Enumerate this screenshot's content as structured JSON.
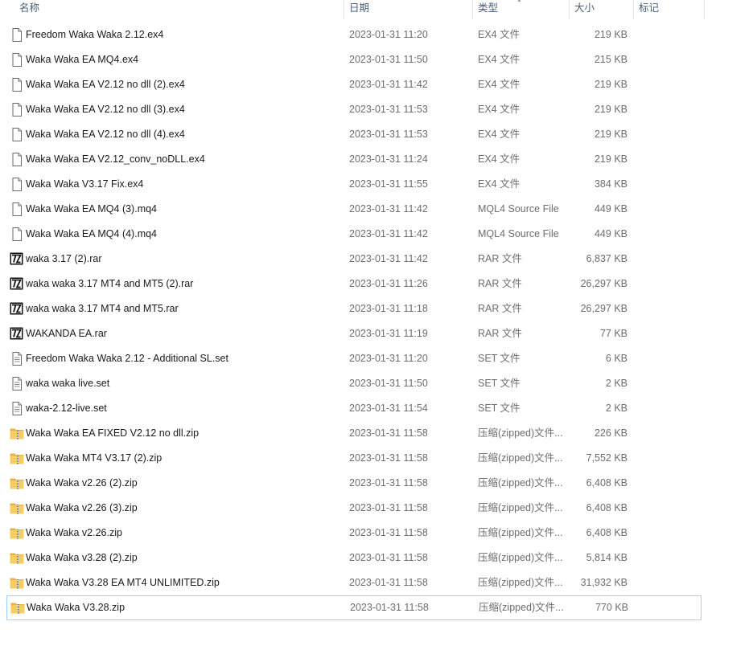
{
  "columns": {
    "name": "名称",
    "date": "日期",
    "type": "类型",
    "size": "大小",
    "tags": "标记"
  },
  "icons": {
    "ex4": "generic-file-icon",
    "mq4": "generic-file-icon",
    "rar": "7zip-archive-icon",
    "set": "text-document-icon",
    "zip": "zip-folder-icon"
  },
  "colors": {
    "selection_border": "#99d1ff",
    "header_text": "#4c607a",
    "secondary_text": "#6d6d6d",
    "folder_yellow": "#f3c55a"
  },
  "files": [
    {
      "name": "Freedom Waka Waka 2.12.ex4",
      "date": "2023-01-31 11:20",
      "type": "EX4 文件",
      "size": "219 KB",
      "icon": "ex4"
    },
    {
      "name": "Waka Waka EA MQ4.ex4",
      "date": "2023-01-31 11:50",
      "type": "EX4 文件",
      "size": "215 KB",
      "icon": "ex4"
    },
    {
      "name": "Waka Waka EA V2.12 no dll (2).ex4",
      "date": "2023-01-31 11:42",
      "type": "EX4 文件",
      "size": "219 KB",
      "icon": "ex4"
    },
    {
      "name": "Waka Waka EA V2.12 no dll (3).ex4",
      "date": "2023-01-31 11:53",
      "type": "EX4 文件",
      "size": "219 KB",
      "icon": "ex4"
    },
    {
      "name": "Waka Waka EA V2.12 no dll (4).ex4",
      "date": "2023-01-31 11:53",
      "type": "EX4 文件",
      "size": "219 KB",
      "icon": "ex4"
    },
    {
      "name": "Waka Waka EA V2.12_conv_noDLL.ex4",
      "date": "2023-01-31 11:24",
      "type": "EX4 文件",
      "size": "219 KB",
      "icon": "ex4"
    },
    {
      "name": "Waka Waka V3.17 Fix.ex4",
      "date": "2023-01-31 11:55",
      "type": "EX4 文件",
      "size": "384 KB",
      "icon": "ex4"
    },
    {
      "name": "Waka Waka EA MQ4 (3).mq4",
      "date": "2023-01-31 11:42",
      "type": "MQL4 Source File",
      "size": "449 KB",
      "icon": "mq4"
    },
    {
      "name": "Waka Waka EA MQ4 (4).mq4",
      "date": "2023-01-31 11:42",
      "type": "MQL4 Source File",
      "size": "449 KB",
      "icon": "mq4"
    },
    {
      "name": "waka 3.17 (2).rar",
      "date": "2023-01-31 11:42",
      "type": "RAR 文件",
      "size": "6,837 KB",
      "icon": "rar"
    },
    {
      "name": "waka waka 3.17 MT4 and MT5 (2).rar",
      "date": "2023-01-31 11:26",
      "type": "RAR 文件",
      "size": "26,297 KB",
      "icon": "rar"
    },
    {
      "name": "waka waka 3.17 MT4 and MT5.rar",
      "date": "2023-01-31 11:18",
      "type": "RAR 文件",
      "size": "26,297 KB",
      "icon": "rar"
    },
    {
      "name": "WAKANDA EA.rar",
      "date": "2023-01-31 11:19",
      "type": "RAR 文件",
      "size": "77 KB",
      "icon": "rar"
    },
    {
      "name": "Freedom Waka Waka 2.12 - Additional SL.set",
      "date": "2023-01-31 11:20",
      "type": "SET 文件",
      "size": "6 KB",
      "icon": "set"
    },
    {
      "name": "waka waka live.set",
      "date": "2023-01-31 11:50",
      "type": "SET 文件",
      "size": "2 KB",
      "icon": "set"
    },
    {
      "name": "waka-2.12-live.set",
      "date": "2023-01-31 11:54",
      "type": "SET 文件",
      "size": "2 KB",
      "icon": "set"
    },
    {
      "name": "Waka Waka EA FIXED V2.12 no dll.zip",
      "date": "2023-01-31 11:58",
      "type": "压缩(zipped)文件...",
      "size": "226 KB",
      "icon": "zip"
    },
    {
      "name": "Waka Waka MT4 V3.17 (2).zip",
      "date": "2023-01-31 11:58",
      "type": "压缩(zipped)文件...",
      "size": "7,552 KB",
      "icon": "zip"
    },
    {
      "name": "Waka Waka v2.26 (2).zip",
      "date": "2023-01-31 11:58",
      "type": "压缩(zipped)文件...",
      "size": "6,408 KB",
      "icon": "zip"
    },
    {
      "name": "Waka Waka v2.26 (3).zip",
      "date": "2023-01-31 11:58",
      "type": "压缩(zipped)文件...",
      "size": "6,408 KB",
      "icon": "zip"
    },
    {
      "name": "Waka Waka v2.26.zip",
      "date": "2023-01-31 11:58",
      "type": "压缩(zipped)文件...",
      "size": "6,408 KB",
      "icon": "zip"
    },
    {
      "name": "Waka Waka v3.28 (2).zip",
      "date": "2023-01-31 11:58",
      "type": "压缩(zipped)文件...",
      "size": "5,814 KB",
      "icon": "zip"
    },
    {
      "name": "Waka Waka V3.28 EA MT4 UNLIMITED.zip",
      "date": "2023-01-31 11:58",
      "type": "压缩(zipped)文件...",
      "size": "31,932 KB",
      "icon": "zip"
    },
    {
      "name": "Waka Waka V3.28.zip",
      "date": "2023-01-31 11:58",
      "type": "压缩(zipped)文件...",
      "size": "770 KB",
      "icon": "zip",
      "selected": true
    }
  ]
}
